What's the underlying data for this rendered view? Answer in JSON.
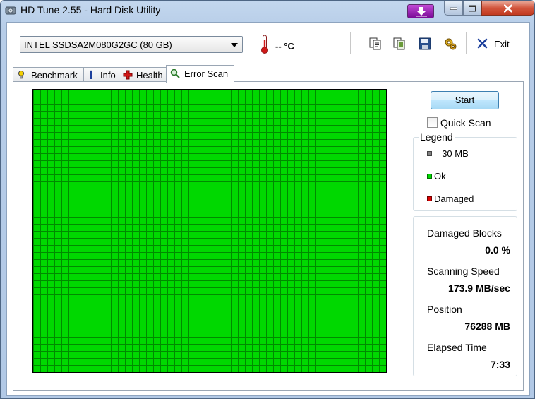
{
  "window": {
    "title": "HD Tune 2.55 - Hard Disk Utility"
  },
  "toolbar": {
    "drive": "INTEL SSDSA2M080G2GC (80 GB)",
    "temperature": "-- °C",
    "exit_label": "Exit",
    "icons": [
      "copy-text-icon",
      "copy-screenshot-icon",
      "save-icon",
      "options-icon"
    ]
  },
  "tabs": [
    {
      "label": "Benchmark",
      "icon": "benchmark-icon",
      "active": false
    },
    {
      "label": "Info",
      "icon": "info-icon",
      "active": false
    },
    {
      "label": "Health",
      "icon": "health-icon",
      "active": false
    },
    {
      "label": "Error Scan",
      "icon": "magnifier-icon",
      "active": true
    }
  ],
  "scan": {
    "start_label": "Start",
    "quick_scan_label": "Quick Scan",
    "quick_scan_checked": false,
    "block_status": "all ok",
    "colors": {
      "ok": "#00d800",
      "damaged": "#e00000",
      "block": "#808080"
    }
  },
  "legend": {
    "title": "Legend",
    "block_size": "= 30 MB",
    "ok": "Ok",
    "damaged": "Damaged"
  },
  "stats": {
    "damaged_blocks_label": "Damaged Blocks",
    "damaged_blocks_value": "0.0 %",
    "scanning_speed_label": "Scanning Speed",
    "scanning_speed_value": "173.9 MB/sec",
    "position_label": "Position",
    "position_value": "76288 MB",
    "elapsed_time_label": "Elapsed Time",
    "elapsed_time_value": "7:33"
  }
}
